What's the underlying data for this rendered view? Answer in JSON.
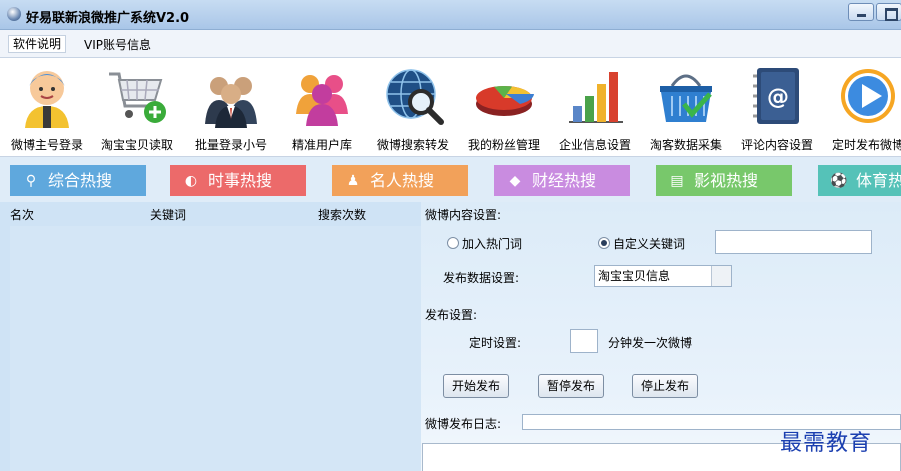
{
  "window": {
    "title": "好易联新浪微推广系统V2.0"
  },
  "menu": {
    "items": [
      "软件说明",
      "VIP账号信息"
    ]
  },
  "toolbar": {
    "items": [
      {
        "label": "微博主号登录",
        "icon": "user-avatar-icon"
      },
      {
        "label": "淘宝宝贝读取",
        "icon": "shopping-cart-icon"
      },
      {
        "label": "批量登录小号",
        "icon": "group-users-icon"
      },
      {
        "label": "精准用户库",
        "icon": "user-database-icon"
      },
      {
        "label": "微博搜索转发",
        "icon": "globe-search-icon"
      },
      {
        "label": "我的粉丝管理",
        "icon": "pie-chart-icon"
      },
      {
        "label": "企业信息设置",
        "icon": "bar-chart-icon"
      },
      {
        "label": "淘客数据采集",
        "icon": "basket-icon"
      },
      {
        "label": "评论内容设置",
        "icon": "address-book-icon"
      },
      {
        "label": "定时发布微博",
        "icon": "play-icon"
      }
    ]
  },
  "tabs": [
    {
      "label": "综合热搜",
      "color": "#5fa8dd",
      "icon": "search-icon"
    },
    {
      "label": "时事热搜",
      "color": "#ec6a6a",
      "icon": "globe-icon"
    },
    {
      "label": "名人热搜",
      "color": "#f2a15a",
      "icon": "person-icon"
    },
    {
      "label": "财经热搜",
      "color": "#c98ce0",
      "icon": "tag-icon"
    },
    {
      "label": "影视热搜",
      "color": "#78c86b",
      "icon": "film-icon"
    },
    {
      "label": "体育热搜",
      "color": "#55c2b8",
      "icon": "ball-icon"
    }
  ],
  "list": {
    "columns": [
      "名次",
      "关键词",
      "搜索次数"
    ]
  },
  "settings": {
    "content_title": "微博内容设置:",
    "radio_hot": "加入热门词",
    "radio_custom": "自定义关键词",
    "custom_keyword_value": "",
    "publish_data_label": "发布数据设置:",
    "publish_data_value": "淘宝宝贝信息",
    "publish_title": "发布设置:",
    "timer_label": "定时设置:",
    "timer_value": "",
    "timer_suffix": "分钟发一次微博",
    "btn_start": "开始发布",
    "btn_pause": "暂停发布",
    "btn_stop": "停止发布",
    "log_label": "微博发布日志:"
  },
  "watermark": "最需教育"
}
